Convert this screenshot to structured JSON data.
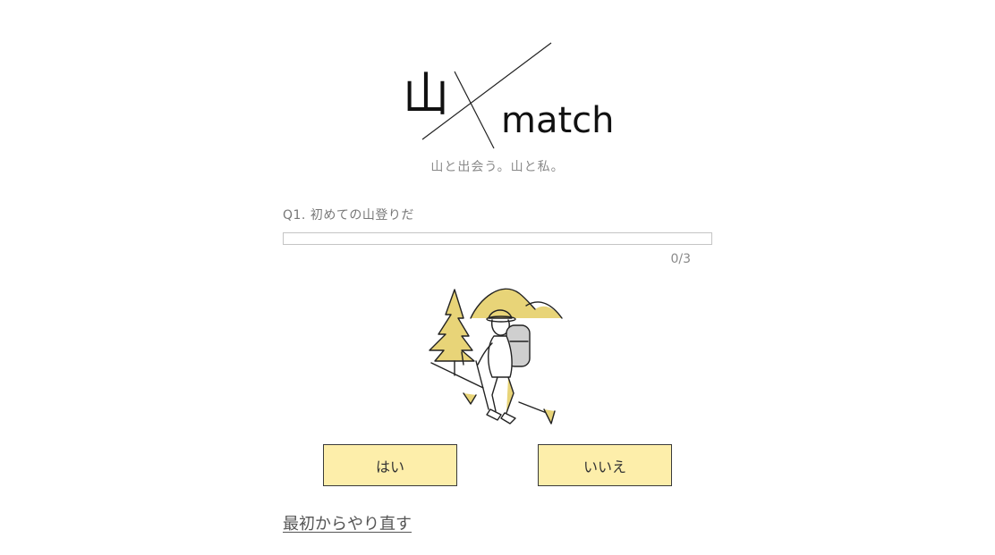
{
  "brand": {
    "logo_kanji": "山",
    "logo_word": "match",
    "tagline": "山と出会う。山と私。"
  },
  "quiz": {
    "question": "Q1. 初めての山登りだ",
    "progress_value": 0,
    "progress_total": 3,
    "progress_text": "0/3"
  },
  "answers": {
    "yes_label": "はい",
    "no_label": "いいえ"
  },
  "restart_label": "最初からやり直す",
  "colors": {
    "accent_yellow": "#E8D478",
    "button_fill": "#FDEEAA",
    "line": "#222222"
  },
  "icons": {
    "illustration": "hiker-with-tree-and-mountains"
  }
}
